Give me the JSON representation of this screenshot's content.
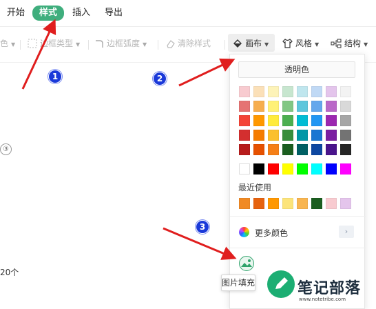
{
  "tabs": [
    {
      "label": "开始",
      "active": false
    },
    {
      "label": "样式",
      "active": true
    },
    {
      "label": "插入",
      "active": false
    },
    {
      "label": "导出",
      "active": false
    }
  ],
  "toolbar": {
    "cut_fill_label": "色",
    "border_type_label": "边框类型",
    "border_radius_label": "边框弧度",
    "clear_style_label": "清除样式",
    "canvas_label": "画布",
    "style_label": "风格",
    "structure_label": "结构"
  },
  "canvas_left": {
    "circled_number": "③",
    "count_text": "20个"
  },
  "badges": [
    "1",
    "2",
    "3"
  ],
  "color_panel": {
    "transparent_label": "透明色",
    "recent_label": "最近使用",
    "more_colors_label": "更多颜色",
    "more_arrow": "›",
    "palette": [
      [
        "#f8cbd0",
        "#fbe0b8",
        "#fdf3b8",
        "#c7e6cf",
        "#bfe6ee",
        "#c0d9f5",
        "#e4c5ec",
        "#f3f3f3"
      ],
      [
        "#e57373",
        "#f6ae4e",
        "#fff176",
        "#81c784",
        "#5cc6dc",
        "#64a7ec",
        "#ba68c8",
        "#d9d9d9"
      ],
      [
        "#f44336",
        "#ff9800",
        "#ffeb3b",
        "#4caf50",
        "#00bcd4",
        "#2196f3",
        "#9c27b0",
        "#a6a6a6"
      ],
      [
        "#d32f2f",
        "#f57c00",
        "#fbc02d",
        "#388e3c",
        "#0097a7",
        "#1976d2",
        "#7b1fa2",
        "#737373"
      ],
      [
        "#b71c1c",
        "#e65100",
        "#f57f17",
        "#1b5e20",
        "#006064",
        "#0d47a1",
        "#4a148c",
        "#262626"
      ]
    ],
    "basic": [
      "#ffffff",
      "#000000",
      "#ff0000",
      "#ffff00",
      "#00ff00",
      "#00ffff",
      "#0000ff",
      "#ff00ff"
    ],
    "recent": [
      "#f08a24",
      "#e6630f",
      "#ff9800",
      "#fce47a",
      "#f8b550",
      "#1b5e20",
      "#f8cbd0",
      "#e4c5ec"
    ],
    "image_fill_tooltip": "图片填充"
  },
  "watermark": {
    "main": "笔记部落",
    "url": "www.notetribe.com"
  },
  "colors": {
    "accent": "#3fae7d",
    "badge": "#1a39d9",
    "arrow": "#e01e1e"
  }
}
